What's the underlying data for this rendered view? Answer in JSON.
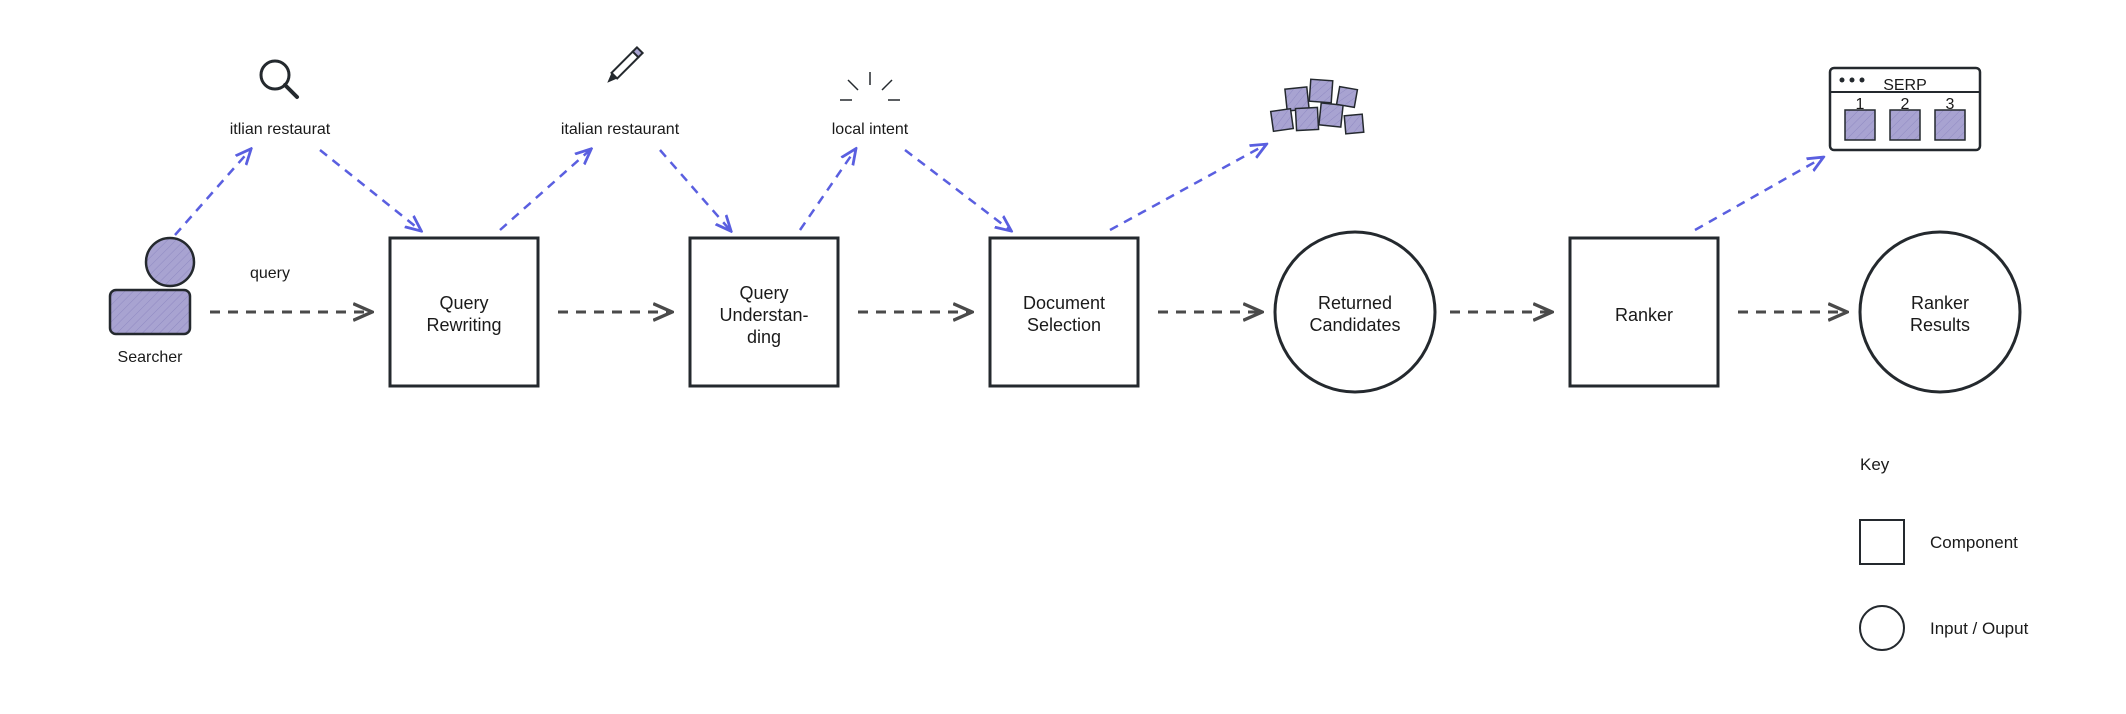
{
  "searcher_label": "Searcher",
  "query_label": "query",
  "annotations": {
    "typo": "itlian restaurat",
    "corrected": "italian restaurant",
    "intent": "local intent"
  },
  "nodes": {
    "rewriting_1": "Query",
    "rewriting_2": "Rewriting",
    "understanding_1": "Query",
    "understanding_2": "Understan-",
    "understanding_3": "ding",
    "docsel_1": "Document",
    "docsel_2": "Selection",
    "candidates_1": "Returned",
    "candidates_2": "Candidates",
    "ranker": "Ranker",
    "results_1": "Ranker",
    "results_2": "Results"
  },
  "serp_label": "SERP",
  "serp_nums": [
    "1",
    "2",
    "3"
  ],
  "key": {
    "title": "Key",
    "component": "Component",
    "io": "Input / Ouput"
  },
  "colors": {
    "outline": "#24292e",
    "lavender": "#a8a3d1",
    "lavender_dark": "#8b86c5",
    "flow_blue": "#5a5fe0",
    "flow_gray": "#4a4a4a"
  }
}
